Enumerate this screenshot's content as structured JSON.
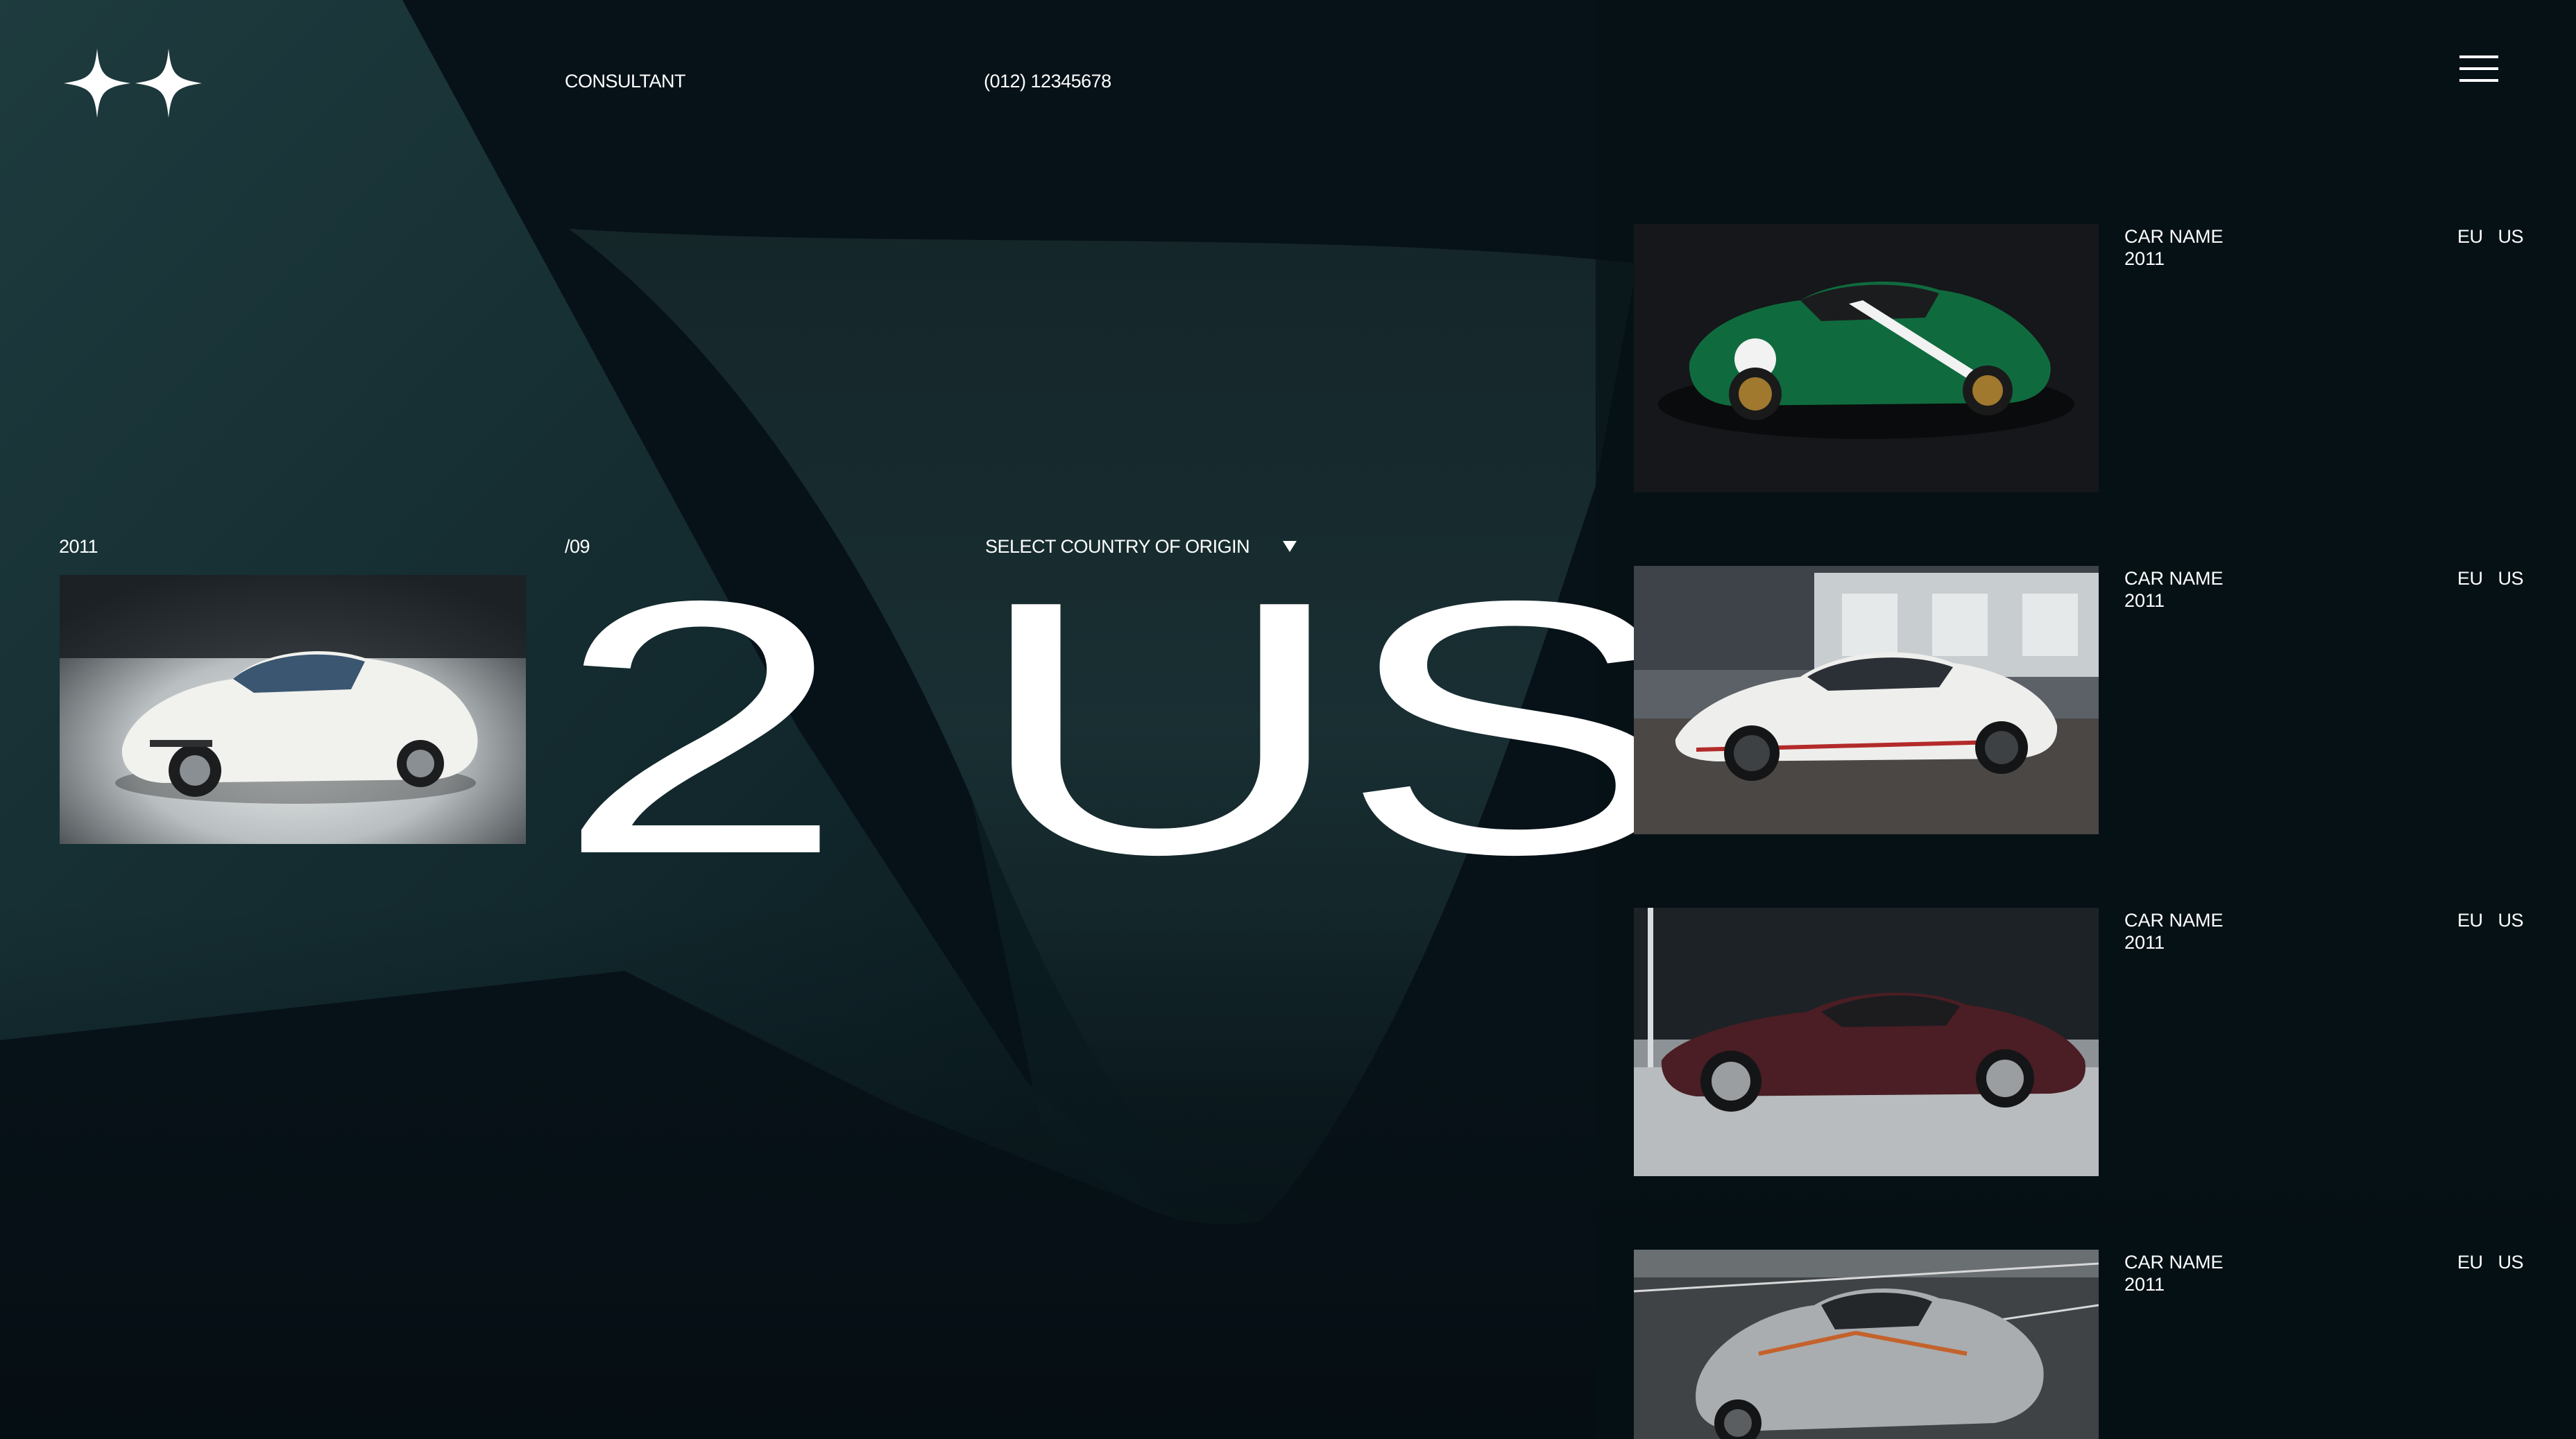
{
  "header": {
    "logo_icon": "double-sparkle-icon",
    "nav_consultant": "CONSULTANT",
    "phone": "(012) 12345678",
    "menu_icon": "hamburger-icon"
  },
  "featured": {
    "year": "2011",
    "index_total": "/09",
    "index_current": "2",
    "country_select_label": "SELECT COUNTRY OF ORIGIN",
    "country_value": "US",
    "caret_icon": "caret-down-icon"
  },
  "listings": [
    {
      "name": "CAR NAME",
      "year": "2011",
      "region_eu": "EU",
      "region_us": "US",
      "car_color": "green"
    },
    {
      "name": "CAR NAME",
      "year": "2011",
      "region_eu": "EU",
      "region_us": "US",
      "car_color": "white"
    },
    {
      "name": "CAR NAME",
      "year": "2011",
      "region_eu": "EU",
      "region_us": "US",
      "car_color": "maroon"
    },
    {
      "name": "CAR NAME",
      "year": "2011",
      "region_eu": "EU",
      "region_us": "US",
      "car_color": "silver"
    }
  ],
  "colors": {
    "background": "#071218",
    "accent_teal": "#1e3a3d",
    "text": "#ffffff"
  }
}
